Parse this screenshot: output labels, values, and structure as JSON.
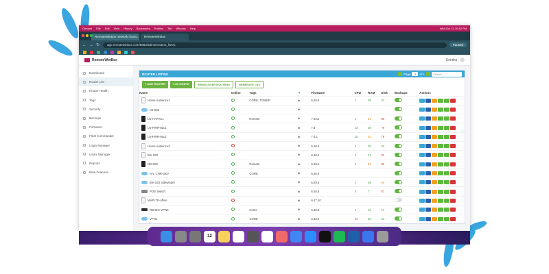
{
  "browser": {
    "menus": [
      "Chrome",
      "File",
      "Edit",
      "View",
      "History",
      "Bookmarks",
      "Profiles",
      "Tab",
      "Window",
      "Help"
    ],
    "clock": "Wed Oct 12  10:42 PM",
    "tabs": [
      "RemoteWinBox network mana...",
      "RemoteWinBox"
    ],
    "url": "app.remotewinbox.com/5983/admin/routers_list?p",
    "paused_label": "Paused"
  },
  "app": {
    "logo_text": "RemoteWinBox",
    "user_name": "Kendra"
  },
  "sidebar": {
    "items": [
      {
        "label": "Dashboard"
      },
      {
        "label": "Router List"
      },
      {
        "label": "Router Health"
      },
      {
        "label": "Tags"
      },
      {
        "label": "Security"
      },
      {
        "label": "Backups"
      },
      {
        "label": "Firmware"
      },
      {
        "label": "Fleet Commander"
      },
      {
        "label": "Login Manager"
      },
      {
        "label": "Users Manager"
      },
      {
        "label": "Reports"
      },
      {
        "label": "Beta Features"
      }
    ]
  },
  "panel": {
    "title": "ROUTER LISTING",
    "page_label": "Page",
    "page_value": "1",
    "page_total": "of 1",
    "search_placeholder": "Search"
  },
  "actions": {
    "add_router": "+ ADD ROUTER",
    "configs": "1 IS CONFIG",
    "rediscover": "REDISCOVER ROUTERS",
    "generate_csv": "GENERATE CSV"
  },
  "table": {
    "headers": [
      "Name",
      "Online",
      "Tags",
      "",
      "Firmware",
      "CPU",
      "RAM",
      "Disk",
      "Backups",
      "Actions"
    ],
    "rows": [
      {
        "name": "Home Audience1",
        "thumb": "white",
        "online": "up",
        "tags": "CORE, TOWER",
        "fw": "6.49.6",
        "cpu": "1",
        "ram": "39",
        "disk": "31",
        "cpu_c": "num-g",
        "ram_c": "num-g",
        "disk_c": "num-g",
        "backup": "on"
      },
      {
        "name": "LN 9S2",
        "thumb": "cloud",
        "online": "up",
        "tags": "",
        "fw": "",
        "cpu": "",
        "ram": "",
        "disk": "",
        "cpu_c": "",
        "ram_c": "",
        "disk_c": "",
        "backup": "on"
      },
      {
        "name": "LN-HAPAC1",
        "thumb": "black",
        "online": "up",
        "tags": "Remote",
        "fw": "7.4rc2",
        "cpu": "1",
        "ram": "51",
        "disk": "80",
        "cpu_c": "num-g",
        "ram_c": "num-o",
        "disk_c": "num-r",
        "backup": "on"
      },
      {
        "name": "LN-PWR-8ac1",
        "thumb": "black",
        "online": "up",
        "tags": "",
        "fw": "7.5",
        "cpu": "23",
        "ram": "48",
        "disk": "79",
        "cpu_c": "num-g",
        "ram_c": "num-g",
        "disk_c": "num-r",
        "backup": "on"
      },
      {
        "name": "LN-PWR-8ac2",
        "thumb": "black",
        "online": "up",
        "tags": "",
        "fw": "7.4.1",
        "cpu": "15",
        "ram": "61",
        "disk": "76",
        "cpu_c": "num-g",
        "ram_c": "num-o",
        "disk_c": "num-r",
        "backup": "on"
      },
      {
        "name": "Home Audience2",
        "thumb": "white",
        "online": "down",
        "tags": "",
        "fw": "6.48.6",
        "cpu": "8",
        "ram": "25",
        "disk": "31",
        "cpu_c": "num-g",
        "ram_c": "num-g",
        "disk_c": "num-g",
        "backup": "on"
      },
      {
        "name": "Bin-3S2",
        "thumb": "white",
        "online": "up",
        "tags": "",
        "fw": "6.48.6",
        "cpu": "0",
        "ram": "47",
        "disk": "91",
        "cpu_c": "num-g",
        "ram_c": "num-g",
        "disk_c": "num-r",
        "backup": "on"
      },
      {
        "name": "ND 9S2",
        "thumb": "black",
        "online": "up",
        "tags": "Remote",
        "fw": "6.48.6",
        "cpu": "8",
        "ram": "51",
        "disk": "80",
        "cpu_c": "num-g",
        "ram_c": "num-o",
        "disk_c": "num-r",
        "backup": "on"
      },
      {
        "name": "ATL CHR-DEV",
        "thumb": "cloud",
        "online": "up",
        "tags": "CORE",
        "fw": "6.46.8",
        "cpu": "",
        "ram": "",
        "disk": "",
        "cpu_c": "",
        "ram_c": "",
        "disk_c": "",
        "backup": "on"
      },
      {
        "name": "Bin-3S2 sidewinder",
        "thumb": "cloud",
        "online": "up",
        "tags": "",
        "fw": "6.48.6",
        "cpu": "0",
        "ram": "45",
        "disk": "60",
        "cpu_c": "num-g",
        "ram_c": "num-g",
        "disk_c": "num-o",
        "backup": "on"
      },
      {
        "name": "POE Switch",
        "thumb": "flat",
        "online": "up",
        "tags": "",
        "fw": "6.48.6",
        "cpu": "3",
        "ram": "7",
        "disk": "87",
        "cpu_c": "num-g",
        "ram_c": "num-g",
        "disk_c": "num-r",
        "backup": "on"
      },
      {
        "name": "MAPLTE-office",
        "thumb": "white",
        "online": "down",
        "tags": "",
        "fw": "6.47.10",
        "cpu": "",
        "ram": "",
        "disk": "",
        "cpu_c": "",
        "ram_c": "",
        "disk_c": "",
        "backup": "off"
      },
      {
        "name": "RBHEX-VPN0",
        "thumb": "ant",
        "online": "up",
        "tags": "Home",
        "fw": "6.48.6",
        "cpu": "0",
        "ram": "11",
        "disk": "17",
        "cpu_c": "num-g",
        "ram_c": "num-g",
        "disk_c": "num-g",
        "backup": "on"
      },
      {
        "name": "VPN1",
        "thumb": "cloud",
        "online": "up",
        "tags": "CORE",
        "fw": "6.48.6",
        "cpu": "91",
        "ram": "26",
        "disk": "34",
        "cpu_c": "num-r",
        "ram_c": "num-g",
        "disk_c": "num-g",
        "backup": "on"
      }
    ]
  },
  "dock": {
    "calendar_day": "12",
    "icons": [
      "finder-icon",
      "launchpad-icon",
      "settings-icon",
      "calendar-icon",
      "notes-icon",
      "reminders-icon",
      "calculator-icon",
      "slack-icon",
      "asana-icon",
      "chrome-icon",
      "zoom-icon",
      "github-icon",
      "spotify-icon",
      "teamviewer-icon",
      "signal-icon",
      "trash-icon"
    ],
    "colors": [
      "#3a8ee6",
      "#888888",
      "#777777",
      "#ffffff",
      "#f6d25c",
      "#ffffff",
      "#555555",
      "#ffffff",
      "#f06a6a",
      "#4285f4",
      "#2d8cff",
      "#111111",
      "#1db954",
      "#1e5fa8",
      "#3a76f0",
      "#9a9a9a"
    ]
  }
}
